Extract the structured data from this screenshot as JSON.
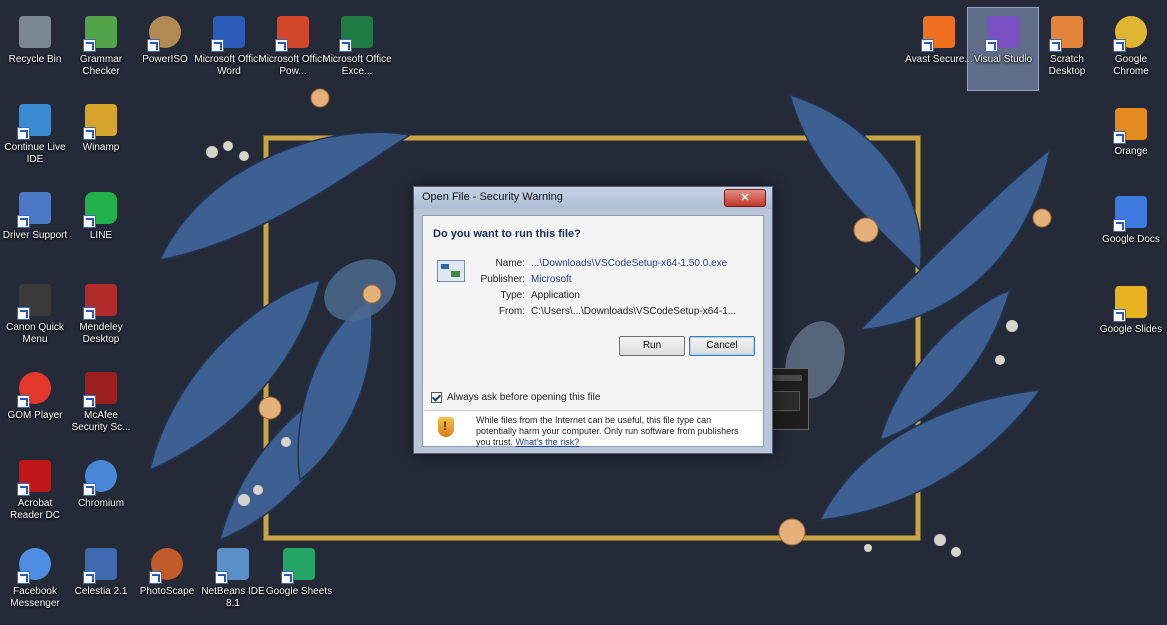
{
  "desktop": {
    "icons_left": [
      {
        "id": "recycle-bin",
        "label": "Recycle Bin",
        "color": "#7c8794",
        "shortcut": false
      },
      {
        "id": "grammar-checker",
        "label": "Grammar Checker",
        "color": "#53a34a",
        "shortcut": true
      },
      {
        "id": "poweriso",
        "label": "PowerISO",
        "color": "#b18b52",
        "shortcut": true
      },
      {
        "id": "word",
        "label": "Microsoft Office Word",
        "color": "#2b5bb8",
        "shortcut": true
      },
      {
        "id": "powerpoint",
        "label": "Microsoft Office Pow...",
        "color": "#d2472a",
        "shortcut": true
      },
      {
        "id": "excel",
        "label": "Microsoft Office Exce...",
        "color": "#1f7a43",
        "shortcut": true
      },
      {
        "id": "continue-ide",
        "label": "Continue Live IDE",
        "color": "#3a8bd1",
        "shortcut": true
      },
      {
        "id": "winamp",
        "label": "Winamp",
        "color": "#d6a42a",
        "shortcut": true
      },
      {
        "id": "driver",
        "label": "Driver Support",
        "color": "#4a78c7",
        "shortcut": true
      },
      {
        "id": "line",
        "label": "LINE",
        "color": "#22b24c",
        "shortcut": true
      },
      {
        "id": "canon",
        "label": "Canon Quick Menu",
        "color": "#3b3b3b",
        "shortcut": true
      },
      {
        "id": "mendeley",
        "label": "Mendeley Desktop",
        "color": "#b22b2b",
        "shortcut": true
      },
      {
        "id": "gom",
        "label": "GOM Player",
        "color": "#e2382b",
        "shortcut": true
      },
      {
        "id": "mcafee",
        "label": "McAfee Security Sc...",
        "color": "#9c1f1f",
        "shortcut": true
      },
      {
        "id": "acrobat",
        "label": "Acrobat Reader DC",
        "color": "#c01818",
        "shortcut": true
      },
      {
        "id": "chromium",
        "label": "Chromium",
        "color": "#4a86d8",
        "shortcut": true
      },
      {
        "id": "wechat",
        "label": "Facebook Messenger",
        "color": "#4f8de0",
        "shortcut": true
      },
      {
        "id": "clip",
        "label": "Celestia 2.1",
        "color": "#3f6bb1",
        "shortcut": true
      },
      {
        "id": "photoscape",
        "label": "PhotoScape",
        "color": "#c25a2a",
        "shortcut": true
      },
      {
        "id": "netbeans",
        "label": "NetBeans IDE 8.1",
        "color": "#5a8fc8",
        "shortcut": true
      },
      {
        "id": "sheets",
        "label": "Google Sheets",
        "color": "#23a566",
        "shortcut": true
      }
    ],
    "icons_right": [
      {
        "id": "avast",
        "label": "Avast Secure...",
        "color": "#f07022",
        "shortcut": true
      },
      {
        "id": "visual-studio",
        "label": "Visual Studio",
        "color": "#7a4fc2",
        "shortcut": true,
        "selected": true
      },
      {
        "id": "scratch",
        "label": "Scratch Desktop",
        "color": "#e4843a",
        "shortcut": true
      },
      {
        "id": "chrome",
        "label": "Google Chrome",
        "color": "#e0b532",
        "shortcut": true
      },
      {
        "id": "orange",
        "label": "Orange",
        "color": "#e38b1f",
        "shortcut": true
      },
      {
        "id": "docs",
        "label": "Google Docs",
        "color": "#3d7ae0",
        "shortcut": true
      },
      {
        "id": "slides",
        "label": "Google Slides",
        "color": "#e8b321",
        "shortcut": true
      }
    ]
  },
  "dialog": {
    "title": "Open File - Security Warning",
    "close_label": "✕",
    "question": "Do you want to run this file?",
    "fields": [
      {
        "key": "Name:",
        "value": "...\\Downloads\\VSCodeSetup-x64-1.50.0.exe",
        "link": true
      },
      {
        "key": "Publisher:",
        "value": "Microsoft",
        "link": true
      },
      {
        "key": "Type:",
        "value": "Application",
        "link": false
      },
      {
        "key": "From:",
        "value": "C:\\Users\\...\\Downloads\\VSCodeSetup-x64-1...",
        "link": false
      }
    ],
    "run_label": "Run",
    "cancel_label": "Cancel",
    "checkbox_label": "Always ask before opening this file",
    "warning_text": "While files from the Internet can be useful, this file type can potentially harm your computer. Only run software from publishers you trust.",
    "warning_link": "What's the risk?"
  }
}
